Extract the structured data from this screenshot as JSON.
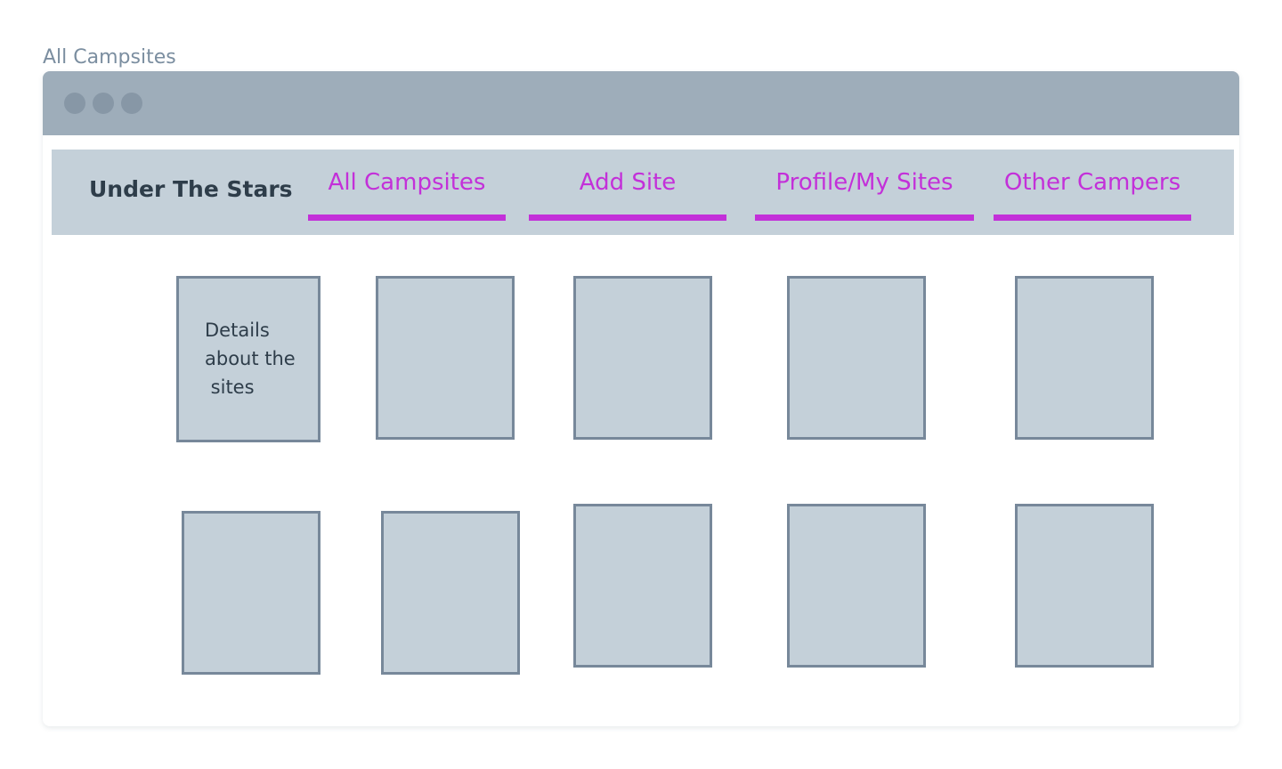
{
  "page": {
    "label": "All Campsites"
  },
  "window": {
    "traffic_lights": [
      "dot-1",
      "dot-2",
      "dot-3"
    ]
  },
  "navbar": {
    "brand": "Under The Stars",
    "links": [
      {
        "label": "All Campsites"
      },
      {
        "label": "Add Site"
      },
      {
        "label": "Profile/My Sites"
      },
      {
        "label": "Other Campers"
      }
    ]
  },
  "grid": {
    "first_card_text": "Details\nabout the\n sites"
  },
  "colors": {
    "titlebar": "#9eadba",
    "navbar": "#c4d0d9",
    "accent": "#c330d9",
    "card_fill": "#c4d0d9",
    "card_border": "#77889a"
  }
}
